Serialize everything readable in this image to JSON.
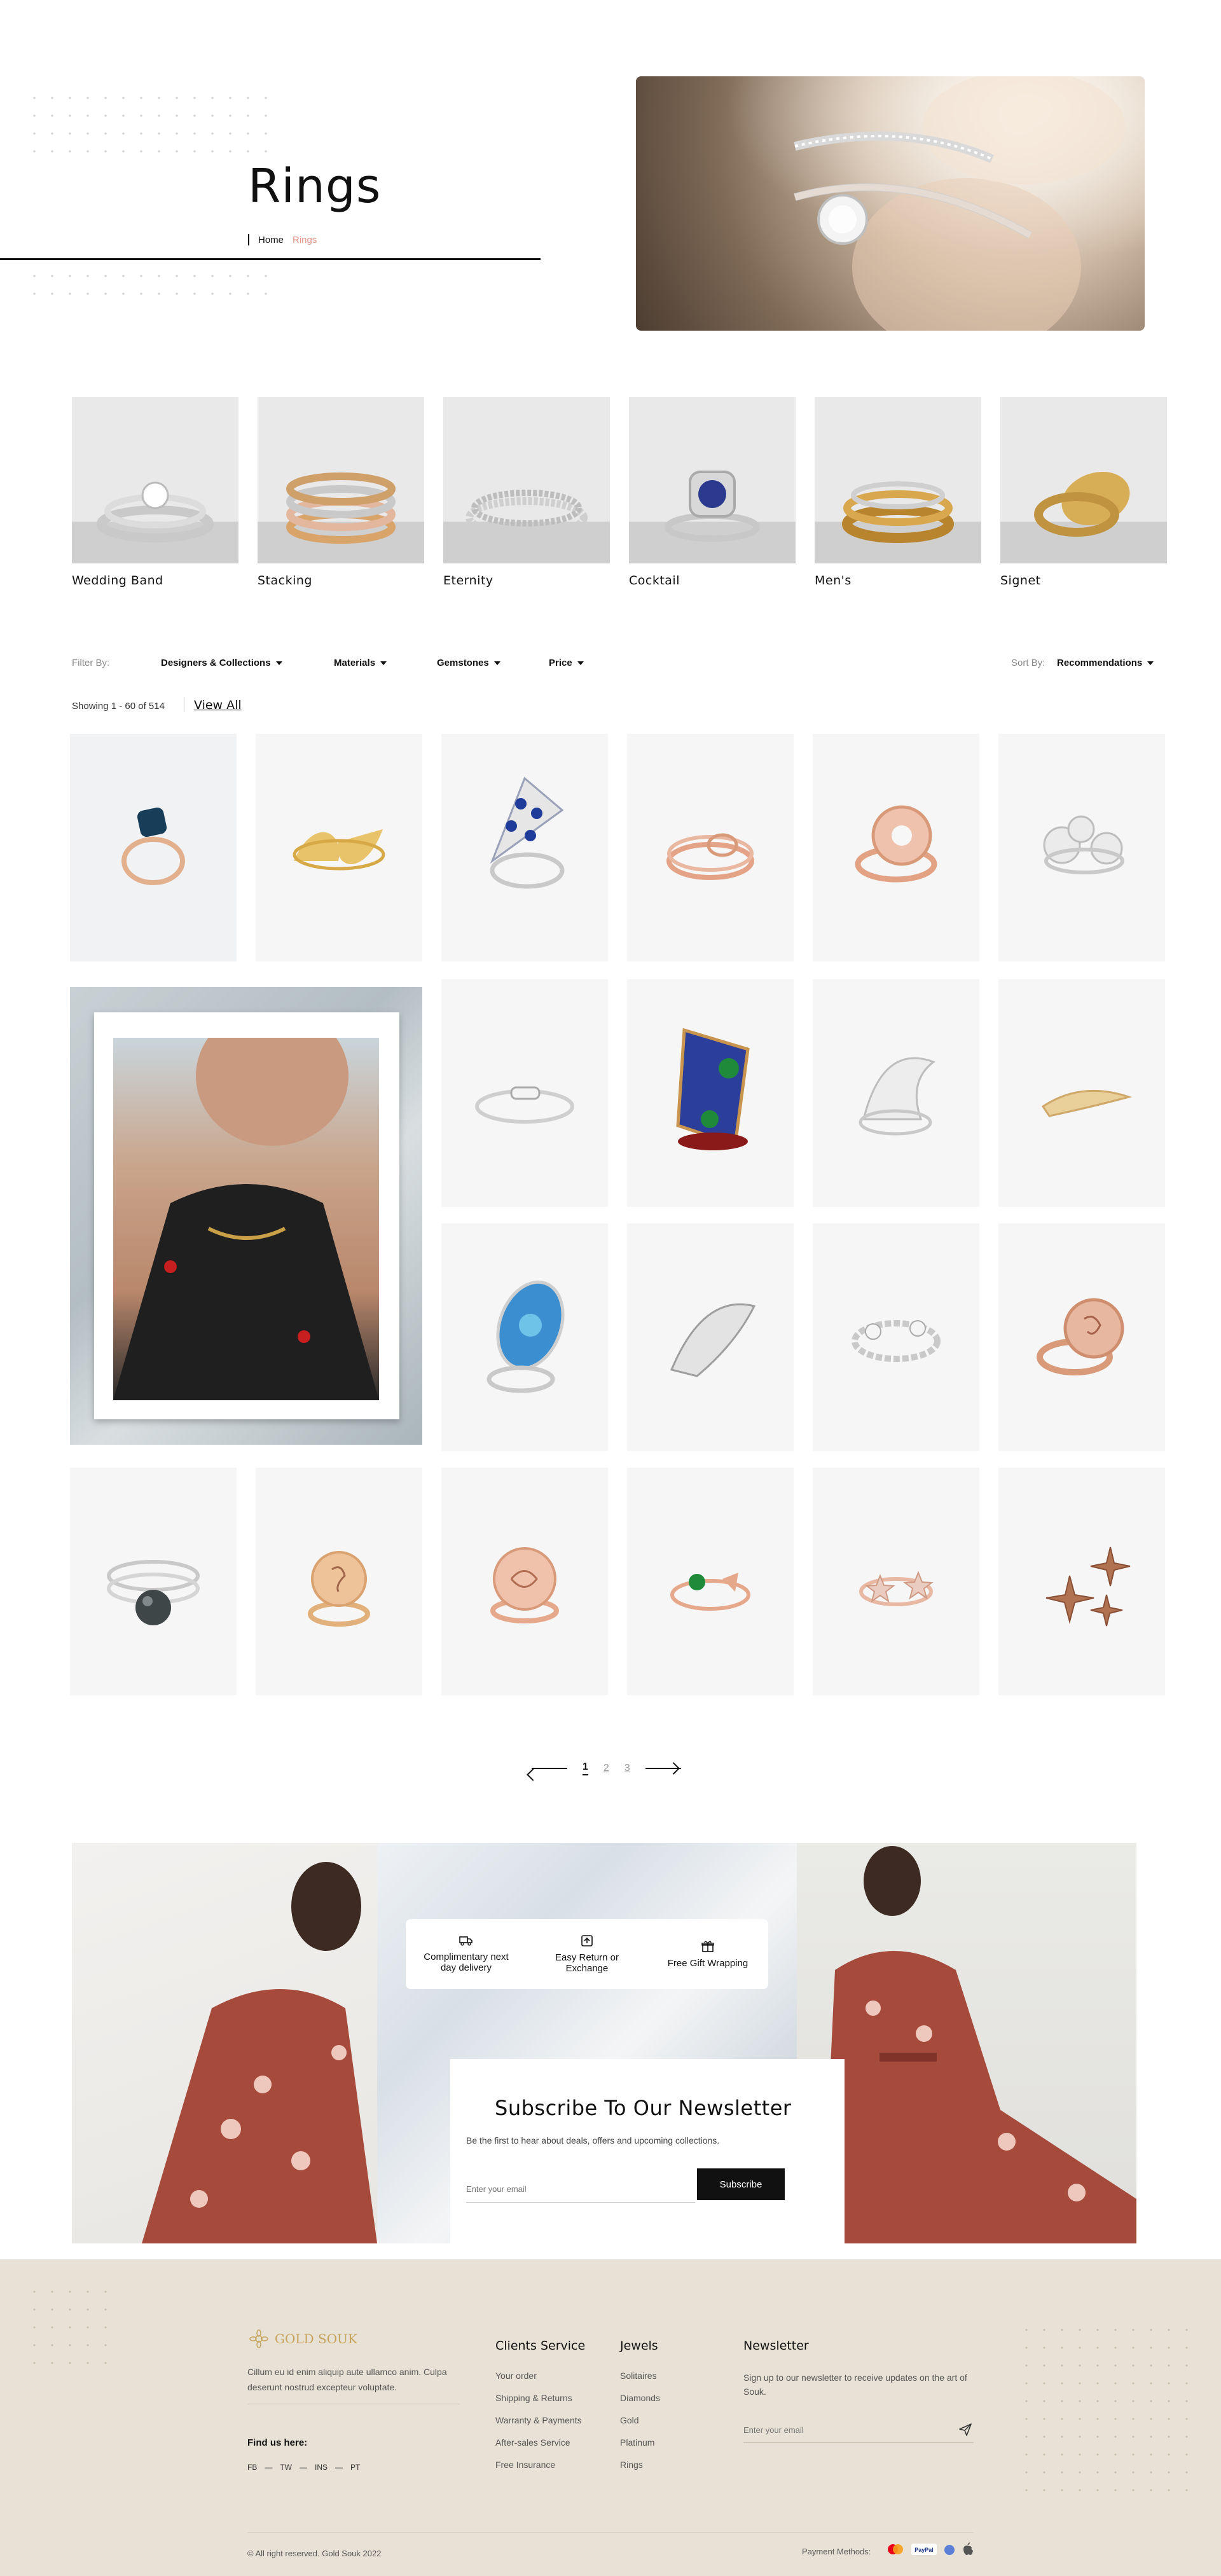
{
  "hero": {
    "title": "Rings",
    "breadcrumb": {
      "home": "Home",
      "current": "Rings"
    }
  },
  "categories": [
    {
      "name": "Wedding Band"
    },
    {
      "name": "Stacking"
    },
    {
      "name": "Eternity"
    },
    {
      "name": "Cocktail"
    },
    {
      "name": "Men's"
    },
    {
      "name": "Signet"
    }
  ],
  "filters": {
    "label": "Filter By:",
    "items": [
      "Designers & Collections",
      "Materials",
      "Gemstones",
      "Price"
    ],
    "sort_label": "Sort By:",
    "sort_value": "Recommendations"
  },
  "results": {
    "showing": "Showing 1 - 60 of 514",
    "view_all": "View All"
  },
  "pagination": {
    "pages": [
      "1",
      "2",
      "3"
    ],
    "current": "1"
  },
  "features": [
    {
      "icon": "truck-icon",
      "label": "Complimentary next day delivery"
    },
    {
      "icon": "return-box-icon",
      "label": "Easy Return or Exchange"
    },
    {
      "icon": "gift-icon",
      "label": "Free Gift Wrapping"
    }
  ],
  "newsletter_banner": {
    "title": "Subscribe To Our Newsletter",
    "subtitle": "Be the first to hear about deals,  offers and upcoming collections.",
    "placeholder": "Enter your email",
    "button": "Subscribe"
  },
  "footer": {
    "brand": "GOLD SOUK",
    "about": "Cillum eu id enim aliquip aute ullamco anim. Culpa deserunt nostrud excepteur voluptate.",
    "find_us": "Find us here:",
    "social": [
      "FB",
      "TW",
      "INS",
      "PT"
    ],
    "clients_service": {
      "title": "Clients Service",
      "links": [
        "Your order",
        "Shipping & Returns",
        "Warranty & Payments",
        "After-sales Service",
        "Free Insurance"
      ]
    },
    "jewels": {
      "title": "Jewels",
      "links": [
        "Solitaires",
        "Diamonds",
        "Gold",
        "Platinum",
        "Rings"
      ]
    },
    "newsletter": {
      "title": "Newsletter",
      "text": "Sign up to our newsletter to receive updates on the art of Souk.",
      "placeholder": "Enter your email"
    },
    "copyright": "© All right reserved. Gold Souk 2022",
    "payment_label": "Payment Methods:",
    "payment_icons": [
      "mastercard-icon",
      "paypal-icon",
      "applepay-icon"
    ]
  },
  "colors": {
    "accent": "#e39386",
    "footer_bg": "#e8e2d6",
    "brand_gold": "#c5a35a"
  }
}
